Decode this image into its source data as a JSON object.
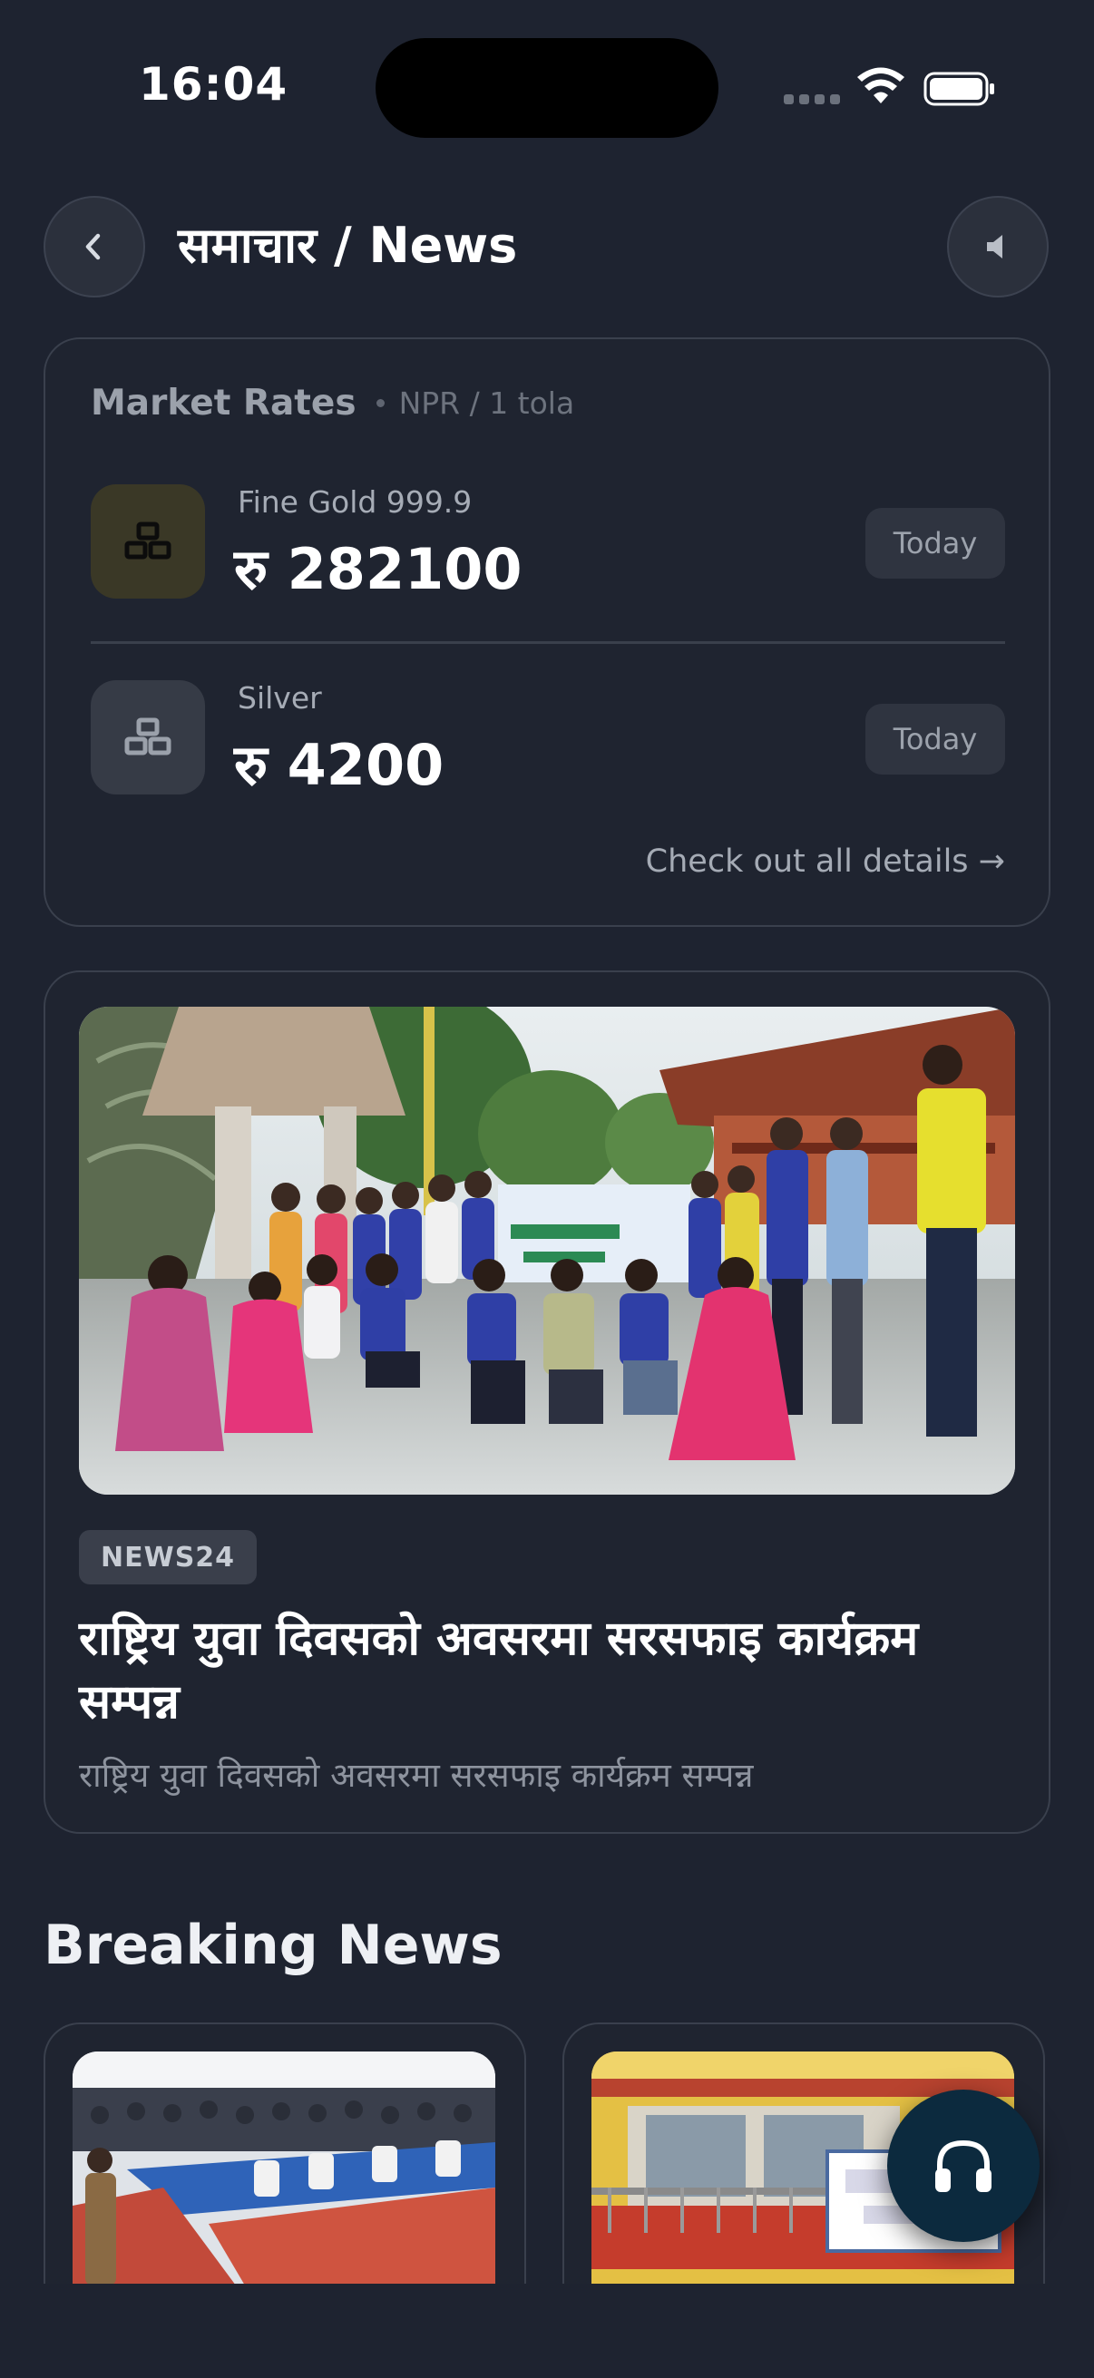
{
  "status_bar": {
    "time": "16:04"
  },
  "header": {
    "title": "समाचार / News",
    "back_icon": "chevron-left-icon",
    "sound_icon": "speaker-icon"
  },
  "market": {
    "title": "Market Rates",
    "unit": "NPR / 1 tola",
    "rates": [
      {
        "label": "Fine Gold 999.9",
        "value": "रु 282100",
        "badge": "Today",
        "icon": "gold-bars-icon",
        "color": "#3a3826"
      },
      {
        "label": "Silver",
        "value": "रु 4200",
        "badge": "Today",
        "icon": "silver-bars-icon",
        "color": "#363b46"
      }
    ],
    "details_link": "Check out all details →"
  },
  "featured": {
    "source": "NEWS24",
    "headline": "राष्ट्रिय युवा दिवसको अवसरमा सरसफाइ कार्यक्रम सम्पन्न",
    "summary": "राष्ट्रिय युवा दिवसको अवसरमा सरसफाइ कार्यक्रम सम्पन्न"
  },
  "breaking": {
    "title": "Breaking News"
  },
  "fab": {
    "icon": "headphones-icon"
  }
}
